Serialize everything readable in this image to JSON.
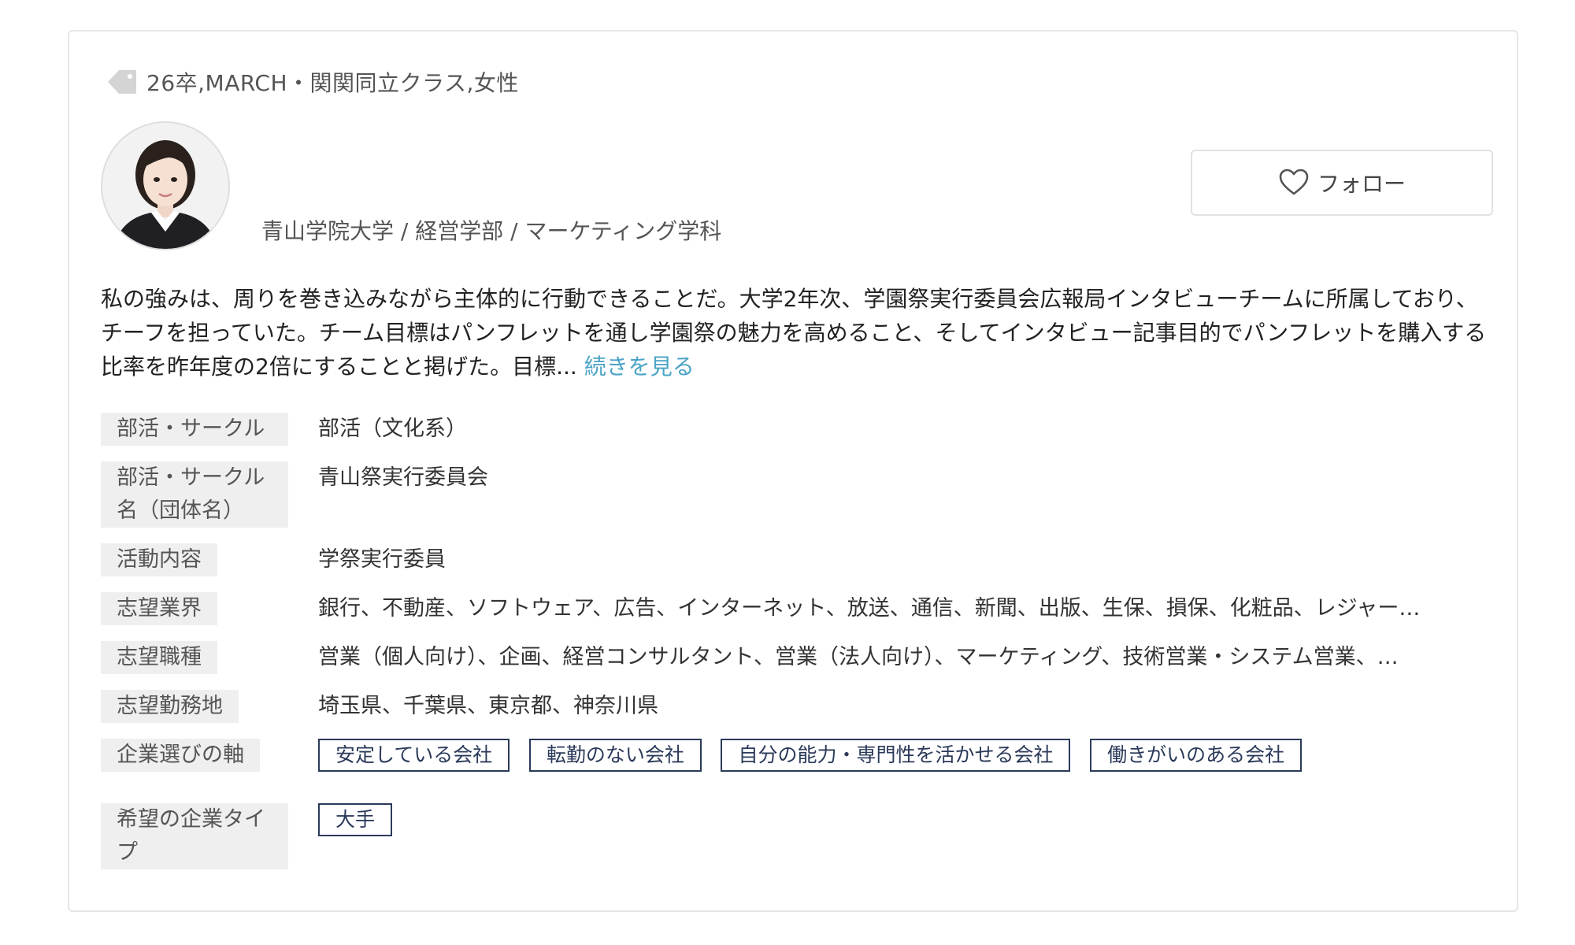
{
  "profile": {
    "tags": "26卒,MARCH・関関同立クラス,女性",
    "school": "青山学院大学 / 経営学部 / マーケティング学科",
    "follow_label": "フォロー",
    "pr_text": "私の強みは、周りを巻き込みながら主体的に行動できることだ。大学2年次、学園祭実行委員会広報局インタビューチームに所属しており、チーフを担っていた。チーム目標はパンフレットを通し学園祭の魅力を高めること、そしてインタビュー記事目的でパンフレットを購入する比率を昨年度の2倍にすることと掲げた。目標... ",
    "read_more": "続きを見る"
  },
  "details": {
    "club_label": "部活・サークル",
    "club_value": "部活（文化系）",
    "club_name_label_1": "部活・サークル",
    "club_name_label_2": "名（団体名）",
    "club_name_value": "青山祭実行委員会",
    "activity_label": "活動内容",
    "activity_value": "学祭実行委員",
    "industry_label": "志望業界",
    "industry_value": "銀行、不動産、ソフトウェア、広告、インターネット、放送、通信、新聞、出版、生保、損保、化粧品、レジャー…",
    "job_label": "志望職種",
    "job_value": "営業（個人向け）、企画、経営コンサルタント、営業（法人向け）、マーケティング、技術営業・システム営業、…",
    "location_label": "志望勤務地",
    "location_value": "埼玉県、千葉県、東京都、神奈川県",
    "axis_label": "企業選びの軸",
    "axis_pills": [
      "安定している会社",
      "転勤のない会社",
      "自分の能力・専門性を活かせる会社",
      "働きがいのある会社"
    ],
    "type_label_1": "希望の企業タイ",
    "type_label_2": "プ",
    "type_pills": [
      "大手"
    ]
  },
  "icons": {
    "tag": "tag-icon",
    "heart": "heart-icon",
    "avatar": "avatar-photo"
  },
  "colors": {
    "accent_link": "#4aa3c6",
    "pill_border": "#2b3a5a",
    "label_bg": "#efefef"
  }
}
